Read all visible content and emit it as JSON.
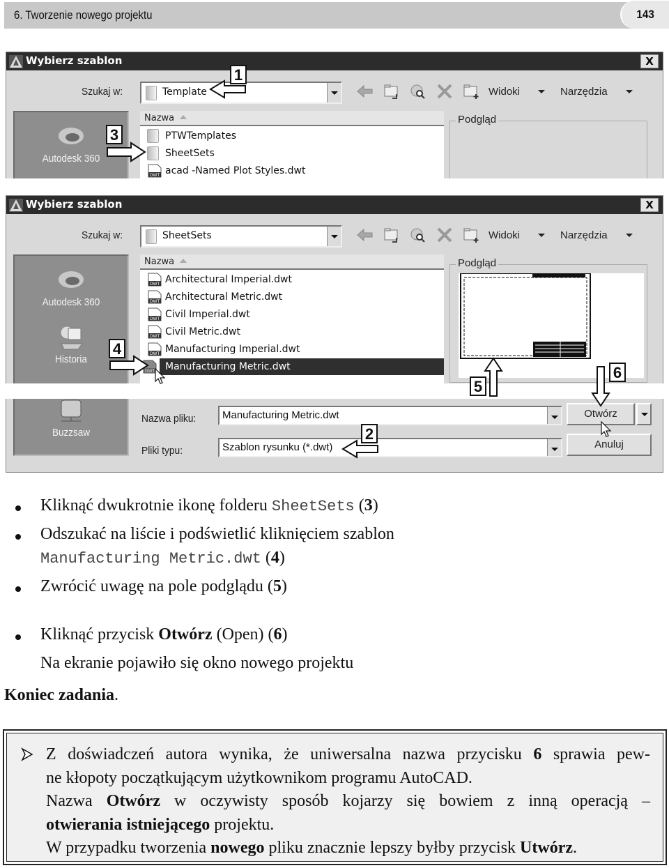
{
  "page_header": {
    "chapter_title": "6. Tworzenie nowego projektu",
    "page_number": "143"
  },
  "dialog1": {
    "title": "Wybierz szablon",
    "close_label": "X",
    "look_in_label": "Szukaj w:",
    "look_in_value": "Template",
    "toolbar": {
      "views_label": "Widoki",
      "tools_label": "Narzędzia"
    },
    "places": [
      {
        "label": "Autodesk 360"
      }
    ],
    "column_header": "Nazwa",
    "files": [
      {
        "name": "PTWTemplates",
        "type": "folder"
      },
      {
        "name": "SheetSets",
        "type": "folder"
      },
      {
        "name": "acad -Named Plot Styles.dwt",
        "type": "dwt"
      }
    ],
    "preview_label": "Podgląd"
  },
  "dialog2": {
    "title": "Wybierz szablon",
    "close_label": "X",
    "look_in_label": "Szukaj w:",
    "look_in_value": "SheetSets",
    "toolbar": {
      "views_label": "Widoki",
      "tools_label": "Narzędzia"
    },
    "places": [
      {
        "label": "Autodesk 360"
      },
      {
        "label": "Historia"
      },
      {
        "label": "Buzzsaw"
      }
    ],
    "column_header": "Nazwa",
    "files": [
      {
        "name": "Architectural Imperial.dwt",
        "type": "dwt"
      },
      {
        "name": "Architectural Metric.dwt",
        "type": "dwt"
      },
      {
        "name": "Civil Imperial.dwt",
        "type": "dwt"
      },
      {
        "name": "Civil Metric.dwt",
        "type": "dwt"
      },
      {
        "name": "Manufacturing Imperial.dwt",
        "type": "dwt"
      },
      {
        "name": "Manufacturing Metric.dwt",
        "type": "dwt",
        "selected": true
      }
    ],
    "preview_label": "Podgląd",
    "filename_label": "Nazwa pliku:",
    "filename_value": "Manufacturing Metric.dwt",
    "filetype_label": "Pliki typu:",
    "filetype_value": "Szablon rysunku (*.dwt)",
    "open_button": "Otwórz",
    "cancel_button": "Anuluj"
  },
  "callouts": [
    "1",
    "2",
    "3",
    "4",
    "5",
    "6"
  ],
  "instructions": {
    "items": [
      {
        "text": "Kliknąć dwukrotnie ikonę folderu ",
        "code": "SheetSets",
        "ref": "3"
      },
      {
        "text": "Odszukać na liście i podświetlić kliknięciem szablon",
        "code": "Manufacturing Metric.dwt",
        "ref": "4"
      },
      {
        "text": "Zwrócić uwagę na pole podglądu ",
        "ref": "5"
      },
      {
        "text": "Kliknąć przycisk ",
        "bold": "Otwórz",
        "after": " (Open) ",
        "ref": "6"
      }
    ],
    "result": "Na ekranie pojawiło się okno nowego projektu",
    "end_bold": "Koniec zadania",
    "end_punct": "."
  },
  "note": {
    "l1_a": "Z doświadczeń autora wynika, że uniwersalna nazwa przycisku ",
    "l1_b": "6",
    "l1_c": " sprawia pew-",
    "l2": "ne kłopoty początkującym użytkownikom programu AutoCAD.",
    "l3_a": "Nazwa ",
    "l3_b": "Otwórz",
    "l3_c": " w oczywisty sposób kojarzy się bowiem z inną operacją –",
    "l4_a": "otwierania istniejącego",
    "l4_b": " projektu.",
    "l5_a": "W przypadku tworzenia ",
    "l5_b": "nowego",
    "l5_c": " pliku znacznie lepszy byłby przycisk ",
    "l5_d": "Utwórz",
    "l5_e": "."
  }
}
